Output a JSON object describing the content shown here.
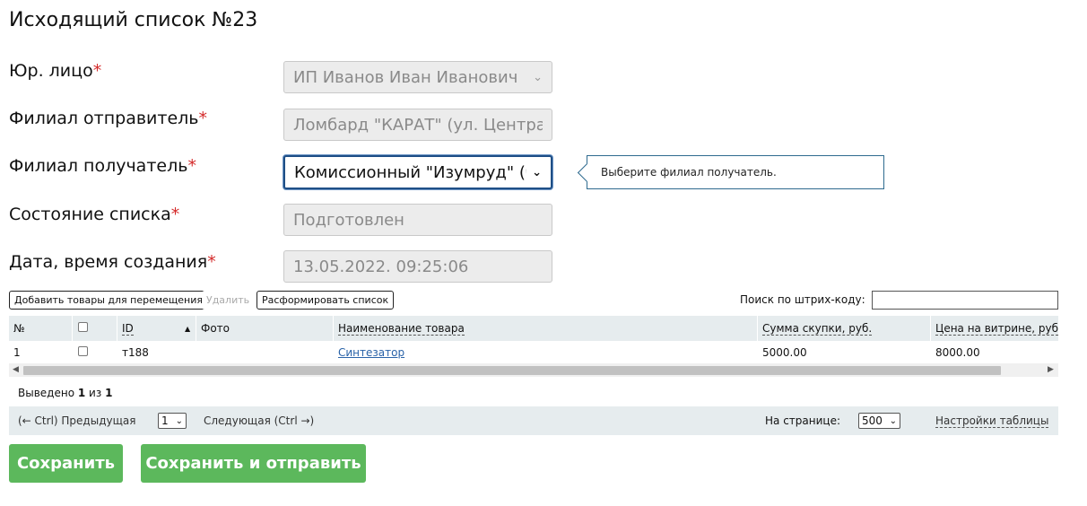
{
  "page_title": "Исходящий список №23",
  "required_mark": "*",
  "form": {
    "legal_entity": {
      "label": "Юр. лицо",
      "value": "ИП Иванов Иван Иванович"
    },
    "sender_branch": {
      "label": "Филиал отправитель",
      "value": "Ломбард \"КАРАТ\" (ул. Централ"
    },
    "recipient_branch": {
      "label": "Филиал получатель",
      "value": "Комиссионный \"Изумруд\" (б-"
    },
    "list_state": {
      "label": "Состояние списка",
      "value": "Подготовлен"
    },
    "created_at": {
      "label": "Дата, время создания",
      "value": "13.05.2022. 09:25:06"
    }
  },
  "tooltip": "Выберите филиал получатель.",
  "toolbar": {
    "add_label": "Добавить товары для перемещения",
    "delete_label": "Удалить",
    "disband_label": "Расформировать список",
    "search_label": "Поиск по штрих-коду:"
  },
  "table": {
    "columns": {
      "num": "№",
      "id": "ID",
      "photo": "Фото",
      "name": "Наименование товара",
      "buy_sum": "Сумма скупки, руб.",
      "shop_price": "Цена на витрине, руб"
    },
    "sort_indicator": "▲",
    "rows": [
      {
        "num": "1",
        "id": "т188",
        "photo": "",
        "name": "Синтезатор",
        "buy_sum": "5000.00",
        "shop_price": "8000.00"
      }
    ]
  },
  "summary": {
    "prefix": "Выведено",
    "shown": "1",
    "sep": "из",
    "total": "1"
  },
  "pager": {
    "prev": "(← Ctrl) Предыдущая",
    "page": "1",
    "next": "Следующая (Ctrl →)",
    "per_page_label": "На странице:",
    "per_page": "500",
    "settings": "Настройки таблицы"
  },
  "actions": {
    "save": "Сохранить",
    "save_send": "Сохранить и отправить"
  },
  "colors": {
    "accent_green": "#5cb85c",
    "required_red": "#d42a2a",
    "link_blue": "#2a63a8",
    "header_bg": "#e6ecee"
  }
}
